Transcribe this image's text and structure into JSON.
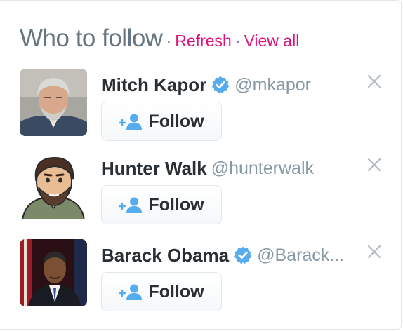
{
  "header": {
    "title": "Who to follow",
    "separator": "·",
    "refresh_label": "Refresh",
    "view_all_label": "View all"
  },
  "suggestions": [
    {
      "name": "Mitch Kapor",
      "handle": "@mkapor",
      "verified": true,
      "follow_label": "Follow"
    },
    {
      "name": "Hunter Walk",
      "handle": "@hunterwalk",
      "verified": false,
      "follow_label": "Follow"
    },
    {
      "name": "Barack Obama",
      "handle": "@Barack...",
      "verified": true,
      "follow_label": "Follow"
    }
  ],
  "colors": {
    "accent_pink": "#e0117a",
    "verified_blue": "#55acee",
    "muted_text": "#66757f",
    "handle_text": "#8899a6",
    "name_text": "#292f33"
  },
  "icons": [
    "verified-badge-icon",
    "add-person-icon",
    "close-icon"
  ]
}
